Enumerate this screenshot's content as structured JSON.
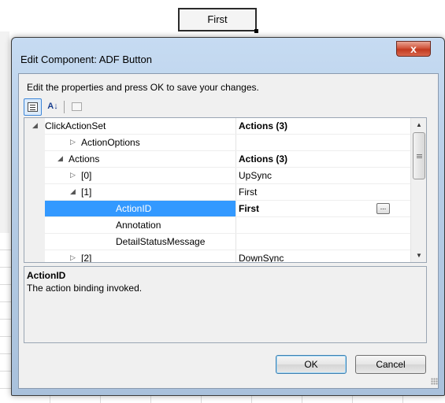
{
  "background": {
    "first_button_label": "First"
  },
  "dialog": {
    "title": "Edit Component: ADF Button",
    "close_label": "x",
    "instructions": "Edit the properties and press OK to save your changes.",
    "toolbar": {
      "categorized_icon": "categorized-icon",
      "alphabetical_label": "A↓",
      "property_pages_icon": "property-pages-icon"
    },
    "property_grid": {
      "rows": [
        {
          "name": "ClickActionSet",
          "value": "Actions (3)",
          "expander": "◢",
          "value_bold": true
        },
        {
          "name": "ActionOptions",
          "value": "",
          "expander": "▷",
          "value_bold": false
        },
        {
          "name": "Actions",
          "value": "Actions (3)",
          "expander": "◢",
          "value_bold": true
        },
        {
          "name": "[0]",
          "value": "UpSync",
          "expander": "▷",
          "value_bold": false
        },
        {
          "name": "[1]",
          "value": "First",
          "expander": "◢",
          "value_bold": false
        },
        {
          "name": "ActionID",
          "value": "First",
          "expander": "",
          "value_bold": true,
          "selected": true,
          "has_ellipsis": true
        },
        {
          "name": "Annotation",
          "value": "",
          "expander": "",
          "value_bold": false
        },
        {
          "name": "DetailStatusMessage",
          "value": "",
          "expander": "",
          "value_bold": false
        },
        {
          "name": "[2]",
          "value": "DownSync",
          "expander": "▷",
          "value_bold": false
        }
      ],
      "ellipsis_label": "...",
      "scroll_up": "▲",
      "scroll_down": "▼"
    },
    "description": {
      "title": "ActionID",
      "text": "The action binding invoked."
    },
    "buttons": {
      "ok": "OK",
      "cancel": "Cancel"
    }
  },
  "colors": {
    "selection": "#3399ff",
    "close_button": "#c13a20",
    "dialog_frame": "#b6cde6"
  }
}
